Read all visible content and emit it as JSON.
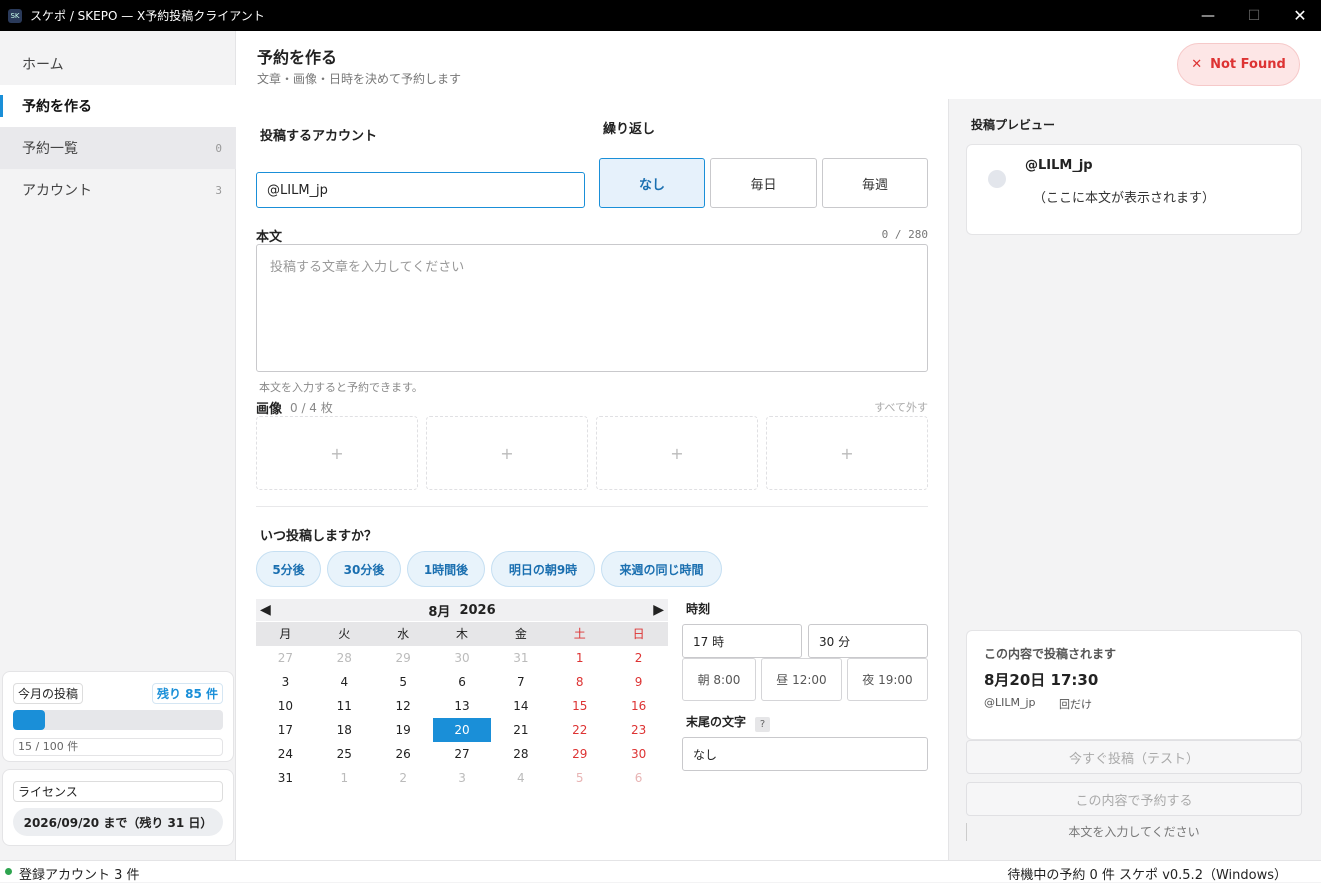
{
  "window": {
    "title": "スケポ / SKEPO — X予約投稿クライアント",
    "app_icon": "SK"
  },
  "sidebar": {
    "items": [
      {
        "label": "ホーム",
        "count": ""
      },
      {
        "label": "予約を作る",
        "count": ""
      },
      {
        "label": "予約一覧",
        "count": "0"
      },
      {
        "label": "アカウント",
        "count": "3"
      }
    ],
    "monthly": {
      "title": "今月の投稿",
      "remaining": "残り 85 件",
      "used_text": "15 / 100 件",
      "progress": 0.15
    },
    "license": {
      "title": "ライセンス",
      "expiry": "2026/09/20 まで（残り 31 日）"
    }
  },
  "header": {
    "title": "予約を作る",
    "subtitle": "文章・画像・日時を決めて予約します",
    "error_label": "Not Found"
  },
  "form": {
    "account_label": "投稿するアカウント",
    "account_value": "@LILM_jp",
    "repeat_label": "繰り返し",
    "repeat_options": [
      "なし",
      "毎日",
      "毎週"
    ],
    "repeat_selected": "なし",
    "body_label": "本文",
    "body_counter": "0 / 280",
    "body_placeholder": "投稿する文章を入力してください",
    "body_hint": "本文を入力すると予約できます。",
    "image_label": "画像",
    "image_count": "0 / 4 枚",
    "image_clear": "すべて外す",
    "image_slot_symbol": "+",
    "when_label": "いつ投稿しますか？",
    "quick_options": [
      "5分後",
      "30分後",
      "1時間後",
      "明日の朝9時",
      "来週の同じ時間"
    ],
    "time_label": "時刻",
    "hour_value": "17 時",
    "minute_value": "30 分",
    "presets": [
      "朝 8:00",
      "昼 12:00",
      "夜 19:00"
    ],
    "suffix_label": "末尾の文字",
    "suffix_help": "?",
    "suffix_value": "なし"
  },
  "calendar": {
    "month_label": "8月",
    "year_label": "2026",
    "weekdays": [
      "月",
      "火",
      "水",
      "木",
      "金",
      "土",
      "日"
    ],
    "weeks": [
      [
        "27",
        "28",
        "29",
        "30",
        "31",
        "1",
        "2"
      ],
      [
        "3",
        "4",
        "5",
        "6",
        "7",
        "8",
        "9"
      ],
      [
        "10",
        "11",
        "12",
        "13",
        "14",
        "15",
        "16"
      ],
      [
        "17",
        "18",
        "19",
        "20",
        "21",
        "22",
        "23"
      ],
      [
        "24",
        "25",
        "26",
        "27",
        "28",
        "29",
        "30"
      ],
      [
        "31",
        "1",
        "2",
        "3",
        "4",
        "5",
        "6"
      ]
    ],
    "selected": "20"
  },
  "preview": {
    "title": "投稿プレビュー",
    "account": "@LILM_jp",
    "body_placeholder": "（ここに本文が表示されます）"
  },
  "summary": {
    "title": "この内容で投稿されます",
    "datetime": "8月20日 17:30",
    "account": "@LILM_jp",
    "repeat": "回だけ",
    "post_now": "今すぐ投稿（テスト）",
    "schedule": "この内容で予約する",
    "hint": "本文を入力してください"
  },
  "status": {
    "accounts": "登録アカウント 3 件",
    "right": "待機中の予約 0 件  スケポ v0.5.2（Windows）",
    "dot_color": "#2ea44f"
  },
  "colors": {
    "accent": "#1a8fd8",
    "error": "#d33333"
  }
}
